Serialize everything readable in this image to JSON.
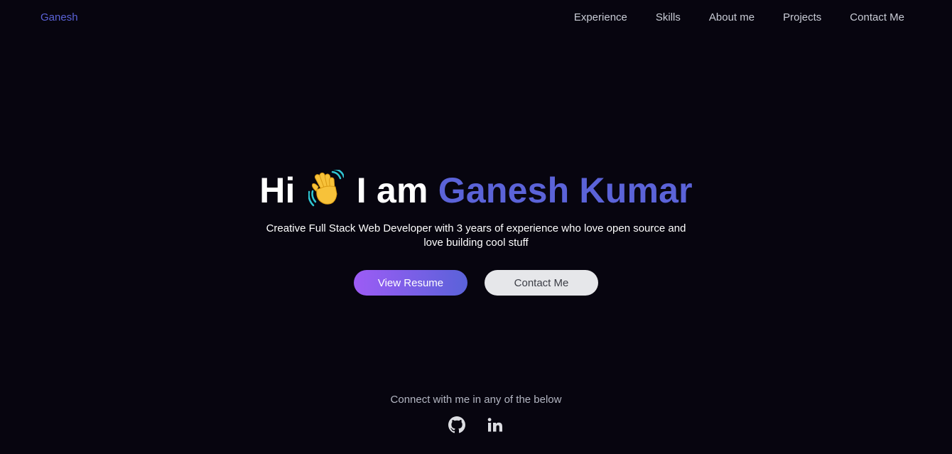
{
  "brand": "Ganesh",
  "nav": {
    "items": [
      "Experience",
      "Skills",
      "About me",
      "Projects",
      "Contact Me"
    ]
  },
  "hero": {
    "greeting": "Hi",
    "wave_icon": "waving-hand-emoji",
    "intro": "I am",
    "name": "Ganesh Kumar",
    "tagline": "Creative Full Stack Web Developer with 3 years of experience who love open source and love building cool stuff",
    "primary_button": "View Resume",
    "secondary_button": "Contact Me"
  },
  "connect": {
    "text": "Connect with me in any of the below",
    "icons": [
      "github-icon",
      "linkedin-icon"
    ]
  },
  "colors": {
    "background": "#07050f",
    "accent": "#5b63d8",
    "gradient_start": "#9d5cf5",
    "gradient_end": "#5a62d9"
  }
}
